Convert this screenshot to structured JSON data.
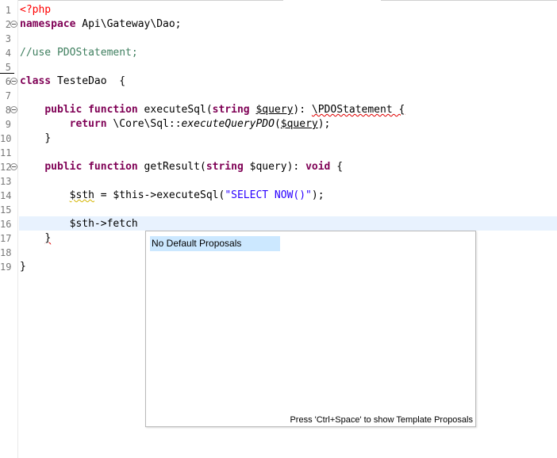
{
  "editor": {
    "lines": [
      {
        "n": "1",
        "fold": false
      },
      {
        "n": "2",
        "fold": true
      },
      {
        "n": "3",
        "fold": false
      },
      {
        "n": "4",
        "fold": false
      },
      {
        "n": "5",
        "fold": false
      },
      {
        "n": "6",
        "fold": true
      },
      {
        "n": "7",
        "fold": false
      },
      {
        "n": "8",
        "fold": true
      },
      {
        "n": "9",
        "fold": false
      },
      {
        "n": "10",
        "fold": false
      },
      {
        "n": "11",
        "fold": false
      },
      {
        "n": "12",
        "fold": true
      },
      {
        "n": "13",
        "fold": false
      },
      {
        "n": "14",
        "fold": false
      },
      {
        "n": "15",
        "fold": false
      },
      {
        "n": "16",
        "fold": false
      },
      {
        "n": "17",
        "fold": false
      },
      {
        "n": "18",
        "fold": false
      },
      {
        "n": "19",
        "fold": false
      }
    ],
    "code": {
      "l1_tag": "<?php",
      "l2_kw": "namespace",
      "l2_rest": " Api\\Gateway\\Dao;",
      "l4_comment": "//use PDOStatement;",
      "l6_kw": "class",
      "l6_rest": " TesteDao  {",
      "l8_kw1": "public",
      "l8_kw2": "function",
      "l8_name": " executeSql(",
      "l8_kw3": "string",
      "l8_var": "$query",
      "l8_mid": "): ",
      "l8_ret": "\\PDOStatement {",
      "l9_kw": "return",
      "l9_a": " \\Core\\",
      "l9_sql": "Sql",
      "l9_b": "::",
      "l9_call": "executeQueryPDO",
      "l9_c": "(",
      "l9_var": "$query",
      "l9_d": ");",
      "l10": "}",
      "l12_kw1": "public",
      "l12_kw2": "function",
      "l12_name": " getResult(",
      "l12_kw3": "string",
      "l12_var": " $query",
      "l12_mid": "): ",
      "l12_kw4": "void",
      "l12_end": " {",
      "l14_var": "$sth",
      "l14_a": " = $this->executeSql(",
      "l14_str": "\"SELECT NOW()\"",
      "l14_b": ");",
      "l16": "$sth->fetch",
      "l17": "}",
      "l19": "}"
    }
  },
  "popup": {
    "proposal": "No Default Proposals",
    "hint": "Press 'Ctrl+Space' to show Template Proposals"
  },
  "colors": {
    "keyword": "#7f0055",
    "php_tag": "#ff0000",
    "comment": "#3f7f5f",
    "string": "#2a00ff",
    "current_line": "#e8f2fe",
    "selection": "#cce8ff"
  }
}
